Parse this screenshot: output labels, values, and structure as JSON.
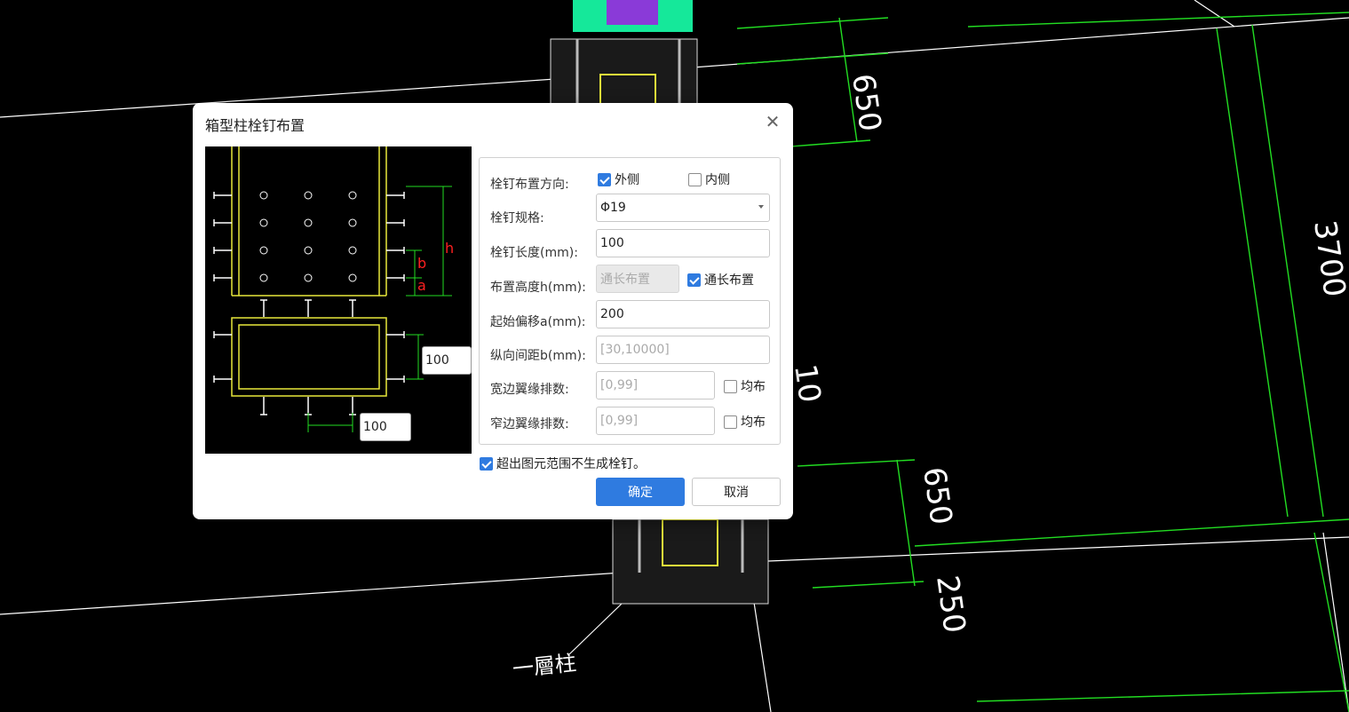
{
  "cad": {
    "dims": [
      "650",
      "3700",
      "650",
      "250"
    ],
    "dim_fragment": "10",
    "label": "一層柱",
    "colors": {
      "dim_line": "#22dd22",
      "column_green": "#15e89a",
      "column_purple": "#8a3ad8"
    }
  },
  "dialog": {
    "title": "箱型柱栓钉布置",
    "close_icon": "close-icon",
    "preview": {
      "labels": {
        "h": "h",
        "b": "b",
        "a": "a"
      },
      "input_right": "100",
      "input_bottom": "100"
    },
    "form": {
      "direction": {
        "label": "栓钉布置方向:",
        "outer": "外侧",
        "inner": "内侧",
        "outer_checked": true,
        "inner_checked": false
      },
      "spec": {
        "label": "栓钉规格:",
        "value": "Φ19"
      },
      "length": {
        "label": "栓钉长度(mm):",
        "value": "100"
      },
      "height": {
        "label": "布置高度h(mm):",
        "value": "通长布置",
        "full_label": "通长布置",
        "full_checked": true
      },
      "offset": {
        "label": "起始偏移a(mm):",
        "value": "200"
      },
      "spacing": {
        "label": "纵向间距b(mm):",
        "placeholder": "[30,10000]"
      },
      "wide": {
        "label": "宽边翼缘排数:",
        "placeholder": "[0,99]",
        "even_label": "均布",
        "even_checked": false
      },
      "narrow": {
        "label": "窄边翼缘排数:",
        "placeholder": "[0,99]",
        "even_label": "均布",
        "even_checked": false
      }
    },
    "skip": {
      "label": "超出图元范围不生成栓钉。",
      "checked": true
    },
    "ok": "确定",
    "cancel": "取消",
    "colors": {
      "accent": "#2f7be0",
      "preview_outline": "#e8e83a",
      "preview_dim": "#22dd22",
      "preview_letter": "#ff2020"
    }
  }
}
